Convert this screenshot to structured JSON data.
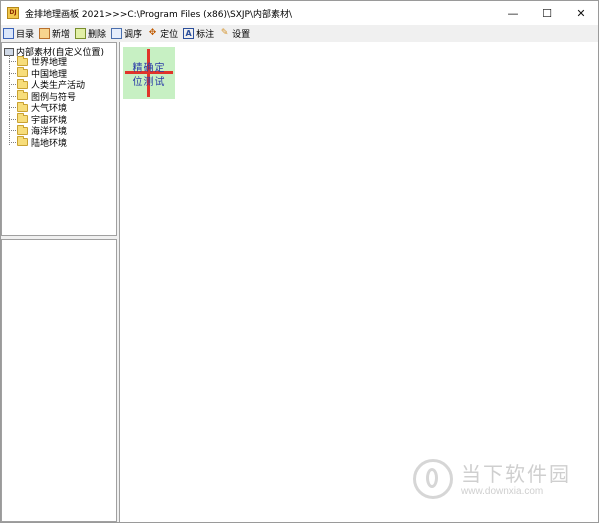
{
  "window": {
    "app_icon_text": "DJ",
    "title": "金排地理画板 2021>>>C:\\Program Files (x86)\\SXJP\\内部素材\\",
    "controls": {
      "minimize": "—",
      "maximize": "☐",
      "close": "✕"
    }
  },
  "toolbar": {
    "items": [
      {
        "label": "目录",
        "icon": "catalog-icon"
      },
      {
        "label": "新增",
        "icon": "add-icon"
      },
      {
        "label": "删除",
        "icon": "delete-icon"
      },
      {
        "label": "调序",
        "icon": "reorder-icon"
      },
      {
        "label": "定位",
        "icon": "locate-icon"
      },
      {
        "label": "标注",
        "icon": "annotate-icon"
      },
      {
        "label": "设置",
        "icon": "settings-icon"
      }
    ],
    "icon_glyphs": {
      "locate": "✥",
      "annotate": "A",
      "settings": "✎"
    }
  },
  "tree": {
    "root_label": "内部素材(自定义位置)",
    "items": [
      {
        "label": "世界地理"
      },
      {
        "label": "中国地理"
      },
      {
        "label": "人类生产活动"
      },
      {
        "label": "图例与符号"
      },
      {
        "label": "大气环境"
      },
      {
        "label": "宇宙环境"
      },
      {
        "label": "海洋环境"
      },
      {
        "label": "陆地环境"
      }
    ]
  },
  "canvas": {
    "thumbnail": {
      "line1": "精确定",
      "line2": "位测试"
    }
  },
  "watermark": {
    "text_cn": "当下软件园",
    "url": "www.downxia.com"
  },
  "colors": {
    "thumb_bg": "#c7f0c3",
    "cross": "#e0342a",
    "thumb_text": "#2a3aa8"
  }
}
